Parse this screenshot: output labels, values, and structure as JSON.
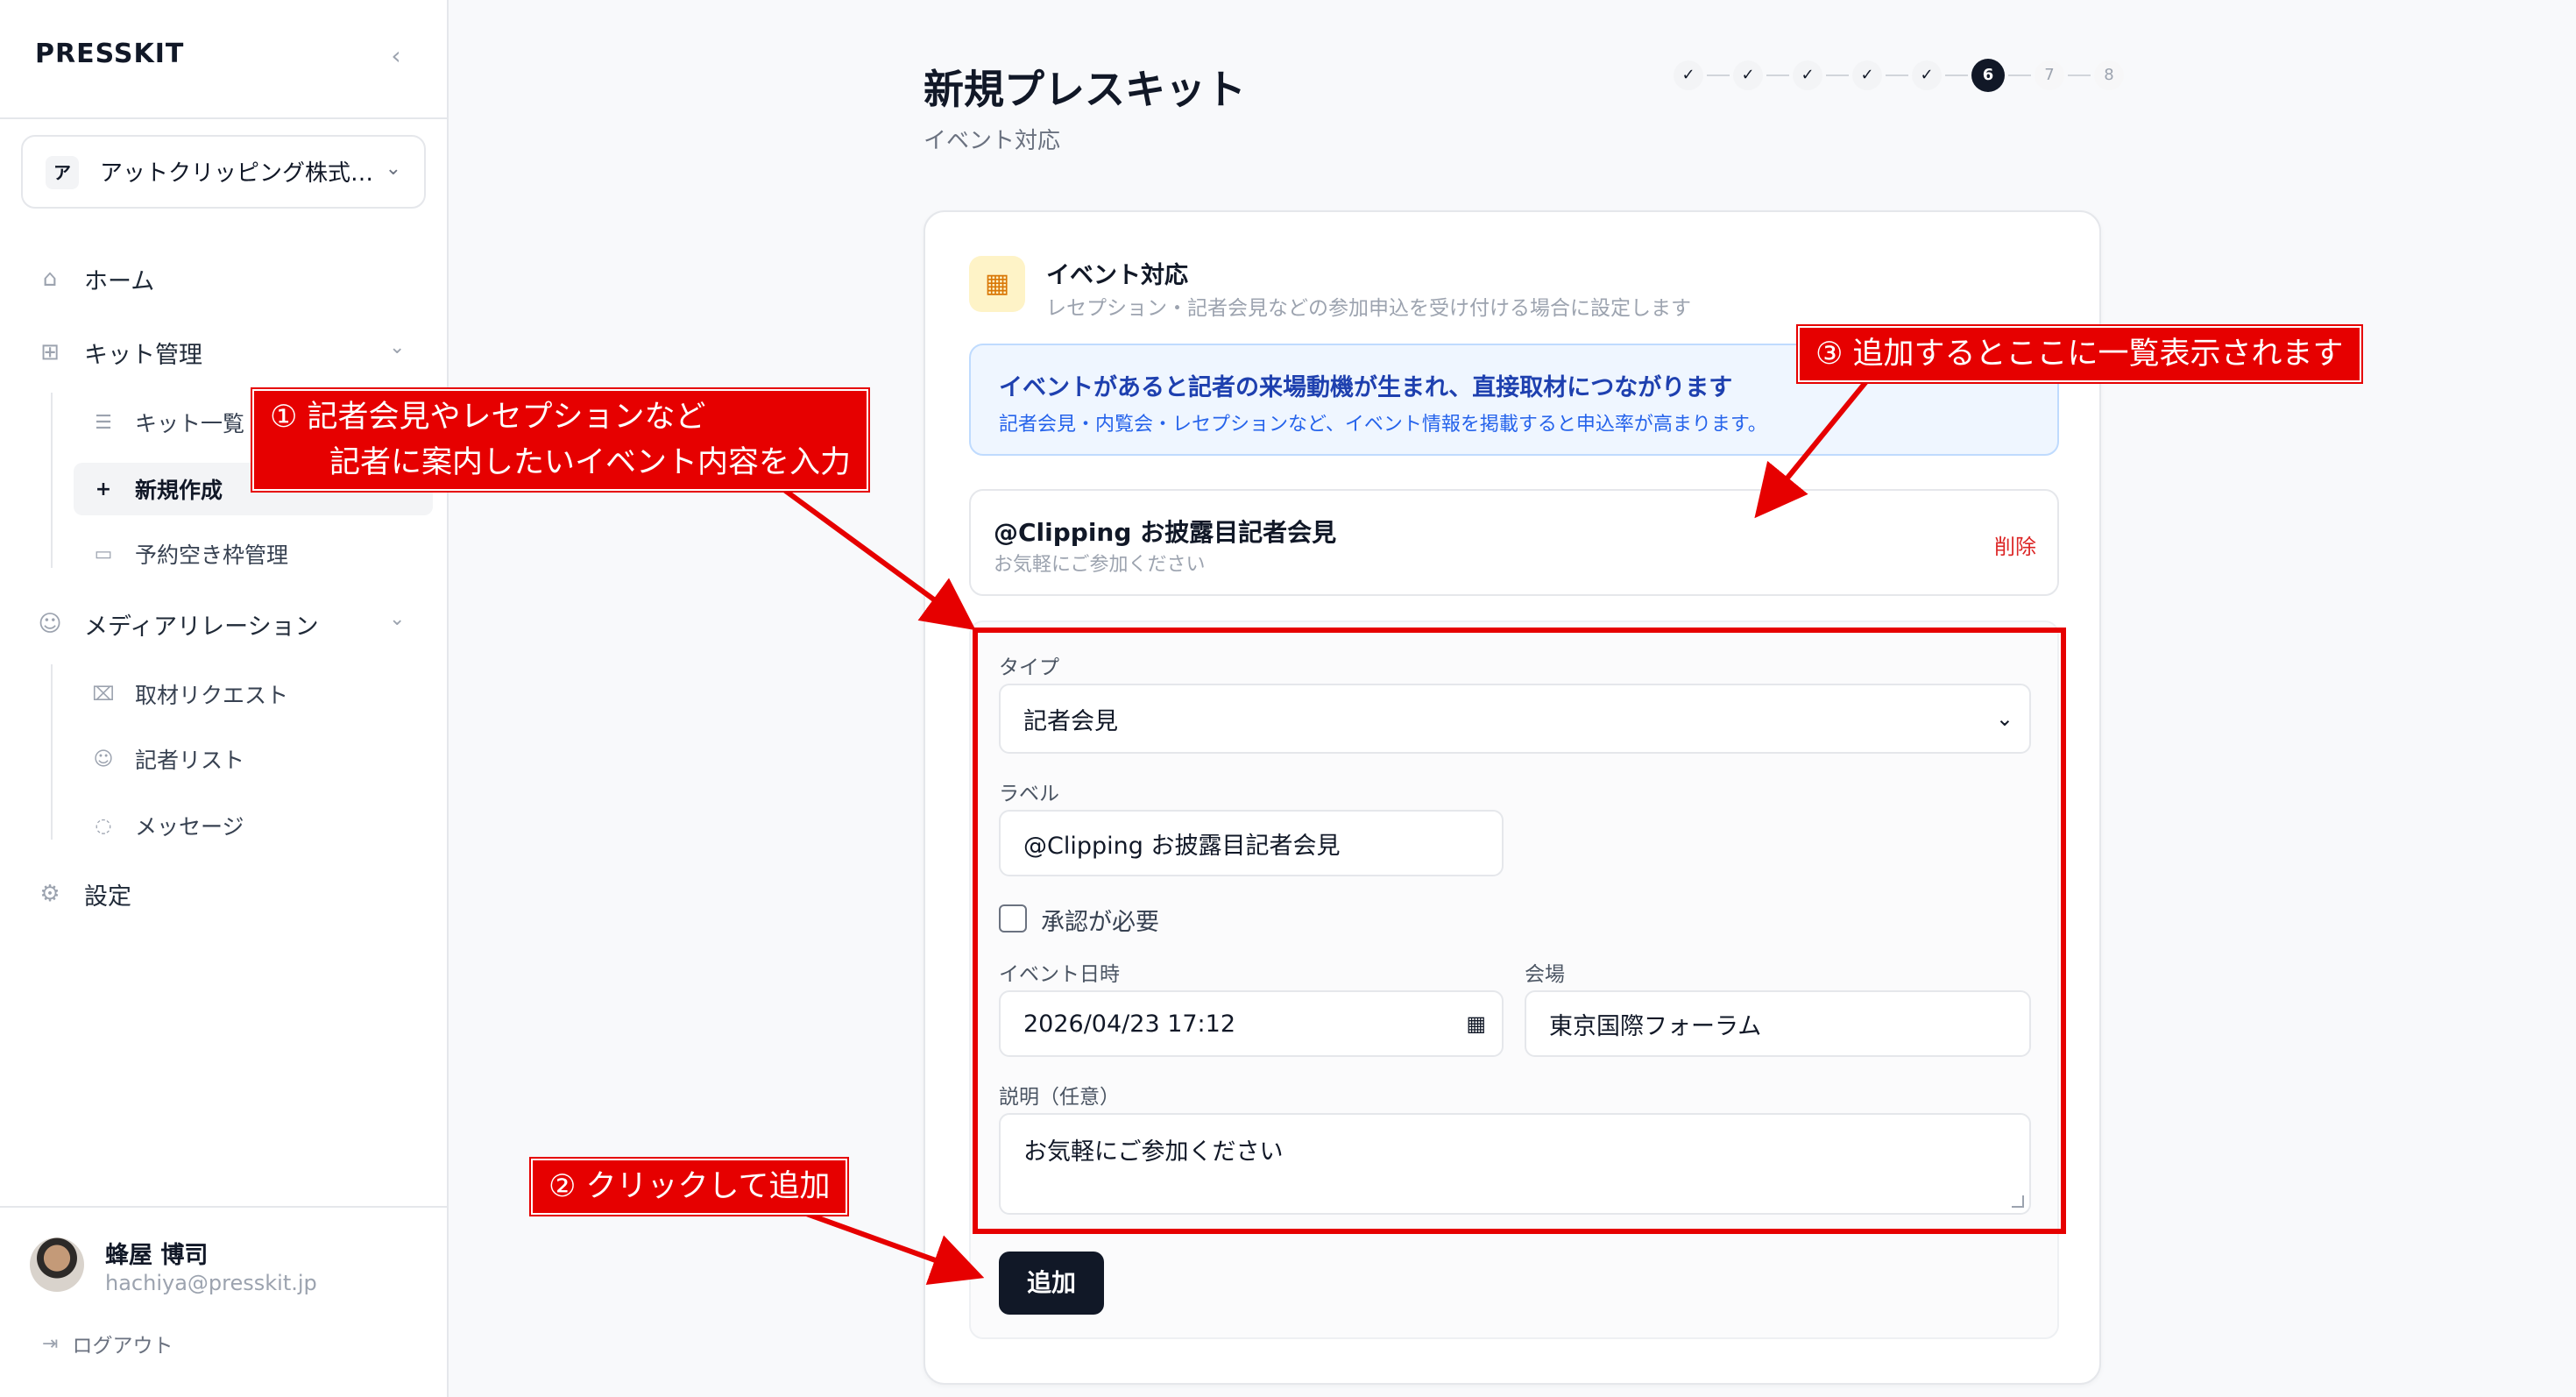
{
  "sidebar": {
    "logo": "PRESSKIT",
    "collapse_icon": "chevron-left-icon",
    "org": {
      "badge": "ア",
      "name": "アットクリッピング株式…"
    },
    "nav": {
      "home": "ホーム",
      "kit": "キット管理",
      "kit_list": "キット一覧",
      "kit_new": "新規作成",
      "slots": "予約空き枠管理",
      "media": "メディアリレーション",
      "requests": "取材リクエスト",
      "journalists": "記者リスト",
      "messages": "メッセージ",
      "settings": "設定"
    },
    "user": {
      "name": "蜂屋 博司",
      "email": "hachiya@presskit.jp"
    },
    "logout": "ログアウト"
  },
  "page": {
    "title": "新規プレスキット",
    "subtitle": "イベント対応"
  },
  "stepper": {
    "done_symbol": "✓",
    "current": "6",
    "todo": [
      "7",
      "8"
    ]
  },
  "section": {
    "title": "イベント対応",
    "description": "レセプション・記者会見などの参加申込を受け付ける場合に設定します",
    "info_title": "イベントがあると記者の来場動機が生まれ、直接取材につながります",
    "info_text": "記者会見・内覧会・レセプションなど、イベント情報を掲載すると申込率が高まります。"
  },
  "event_item": {
    "label": "@Clipping お披露目記者会見",
    "description": "お気軽にご参加ください",
    "delete": "削除"
  },
  "form": {
    "type_label": "タイプ",
    "type_value": "記者会見",
    "label_label": "ラベル",
    "label_value": "@Clipping お披露目記者会見",
    "approval_label": "承認が必要",
    "approval_checked": false,
    "datetime_label": "イベント日時",
    "datetime_value": "2026/04/23 17:12",
    "venue_label": "会場",
    "venue_value": "東京国際フォーラム",
    "desc_label": "説明（任意）",
    "desc_value": "お気軽にご参加ください",
    "add_button": "追加"
  },
  "annotations": {
    "note1_line1": "① 記者会見やレセプションなど",
    "note1_line2": "記者に案内したいイベント内容を入力",
    "note2": "② クリックして追加",
    "note3": "③ 追加するとここに一覧表示されます",
    "color": "#e60000"
  }
}
